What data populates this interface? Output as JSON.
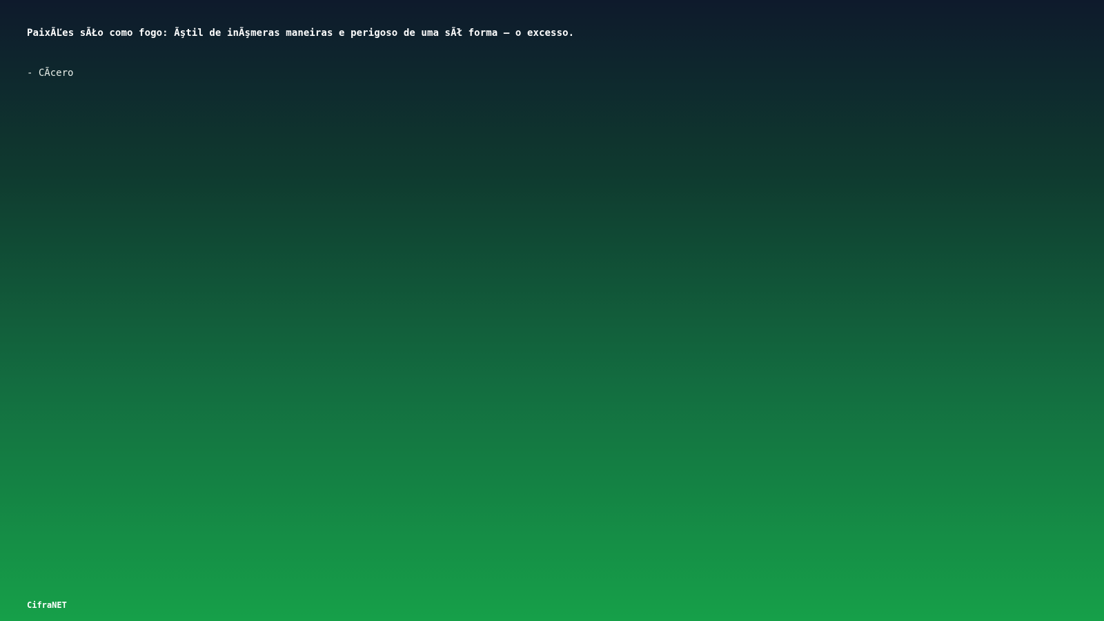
{
  "quote": {
    "text": "PaixÃĽes sÃŁo como fogo: Ãştil de inÃşmeras maneiras e perigoso de uma sÃł forma – o excesso.",
    "author": "- CÃ­cero"
  },
  "footer": {
    "brand": "CifraNET"
  },
  "colors": {
    "gradient_top": "#0e1a2c",
    "gradient_bottom": "#16a049",
    "text": "#ffffff"
  }
}
